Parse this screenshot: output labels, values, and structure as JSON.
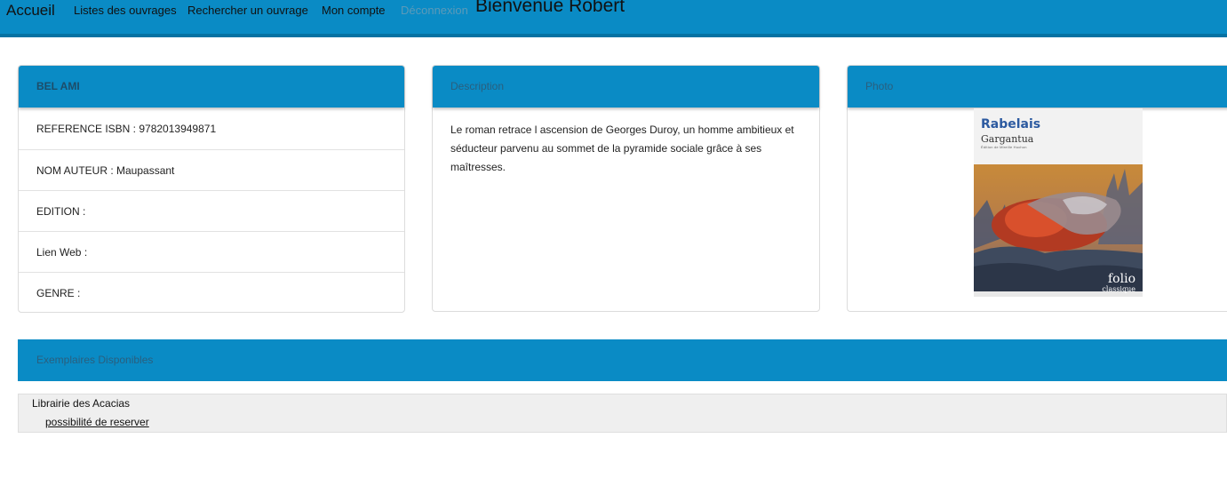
{
  "navbar": {
    "brand": "Accueil",
    "links": [
      "Listes des ouvrages",
      "Rechercher un ouvrage",
      "Mon compte",
      "Déconnexion"
    ],
    "welcome": "Bienvenue Robert",
    "bg_color": "#0a8bc5"
  },
  "book_panel": {
    "title": "BEL AMI",
    "rows": [
      "REFERENCE ISBN : 9782013949871",
      "NOM AUTEUR : Maupassant",
      "EDITION :",
      "Lien Web :",
      "GENRE :"
    ]
  },
  "description_panel": {
    "title": "Description",
    "text": "Le roman retrace l ascension de Georges Duroy, un homme ambitieux et séducteur parvenu au sommet de la pyramide sociale grâce à ses maîtresses."
  },
  "photo_panel": {
    "title": "Photo",
    "cover": {
      "author": "Rabelais",
      "title": "Gargantua",
      "edition": "Édition de Mireille Huchon",
      "collection": "folio",
      "collection_sub": "classique"
    }
  },
  "exemplaires": {
    "title": "Exemplaires Disponibles",
    "items": [
      {
        "library": "Librairie des Acacias",
        "action": "possibilité de reserver"
      }
    ]
  }
}
